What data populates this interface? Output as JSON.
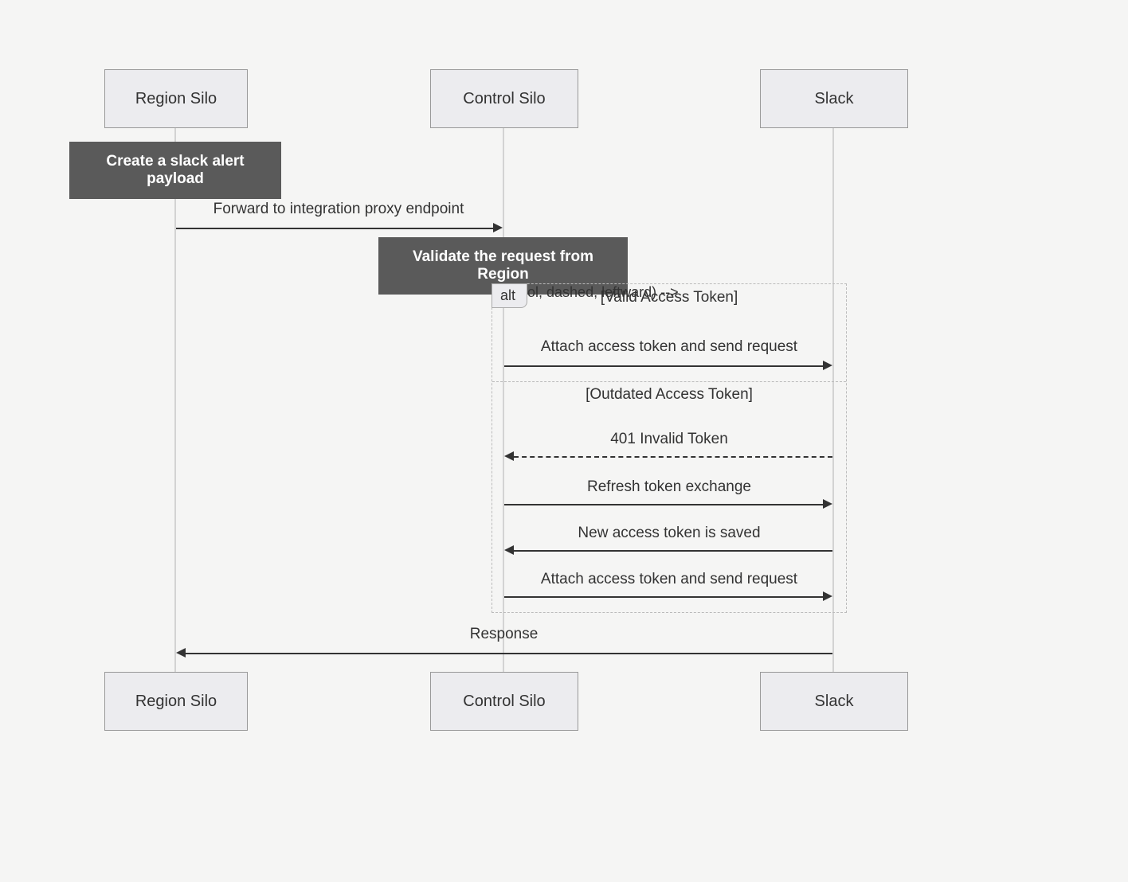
{
  "participants": {
    "region": {
      "label": "Region Silo"
    },
    "control": {
      "label": "Control Silo"
    },
    "slack": {
      "label": "Slack"
    }
  },
  "notes": {
    "createPayload": "Create a slack alert payload",
    "validateRequest": "Validate the request from Region"
  },
  "messages": {
    "forward": "Forward to integration proxy endpoint",
    "attachSend1": "Attach access token and send request",
    "invalidToken": "401 Invalid Token",
    "refreshExchange": "Refresh token exchange",
    "newTokenSaved": "New access token is saved",
    "attachSend2": "Attach access token and send request",
    "response": "Response"
  },
  "alt": {
    "tag": "alt",
    "guardValid": "[Valid Access Token]",
    "guardOutdated": "[Outdated Access Token]"
  }
}
